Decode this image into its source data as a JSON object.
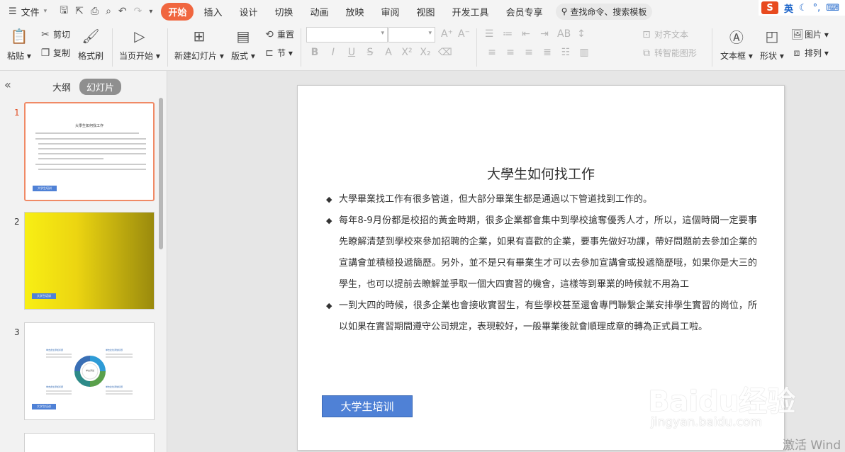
{
  "menubar": {
    "file_label": "文件",
    "tabs": [
      "开始",
      "插入",
      "设计",
      "切换",
      "动画",
      "放映",
      "审阅",
      "视图",
      "开发工具",
      "会员专享"
    ],
    "active_tab": "开始",
    "search_placeholder": "查找命令、搜索模板"
  },
  "ime": {
    "lang": "英"
  },
  "ribbon": {
    "paste": "粘贴",
    "cut": "剪切",
    "copy": "复制",
    "format_painter": "格式刷",
    "from_current": "当页开始",
    "new_slide": "新建幻灯片",
    "layout": "版式",
    "reset": "重置",
    "section": "节",
    "align_text": "对齐文本",
    "to_smartart": "转智能图形",
    "textbox": "文本框",
    "shapes": "形状",
    "picture": "图片",
    "arrange": "排列"
  },
  "left_pane": {
    "tab_outline": "大纲",
    "tab_slides": "幻灯片",
    "slides": [
      {
        "number": "1",
        "title": "大學生如何找工作",
        "button": "大学生培训"
      },
      {
        "number": "2",
        "button": "大学生培训"
      },
      {
        "number": "3",
        "button": "大学生培训",
        "center_label": "单击添加",
        "quadrant_label": "单击此处添加标题"
      }
    ]
  },
  "slide": {
    "title": "大學生如何找工作",
    "bullets": [
      "大學畢業找工作有很多管道，但大部分畢業生都是通過以下管道找到工作的。",
      "每年8-9月份都是校招的黃金時期，很多企業都會集中到學校搶奪優秀人才，所以，這個時間一定要事先瞭解清楚到學校來參加招聘的企業，如果有喜歡的企業，要事先做好功課，帶好問題前去參加企業的宣講會並積極投遞簡歷。另外，並不是只有畢業生才可以去參加宣講會或投遞簡歷哦，如果你是大三的學生，也可以提前去瞭解並爭取一個大四實習的機會，這樣等到畢業的時候就不用為工",
      "一到大四的時候，很多企業也會接收實習生，有些學校甚至還會專門聯繫企業安排學生實習的崗位，所以如果在實習期間遵守公司規定，表現較好，一般畢業後就會順理成章的轉為正式員工啦。"
    ],
    "button": "大学生培训"
  },
  "watermark": {
    "brand": "Baidu经验",
    "url": "jingyan.baidu.com"
  },
  "os_notice": "激活 Wind"
}
